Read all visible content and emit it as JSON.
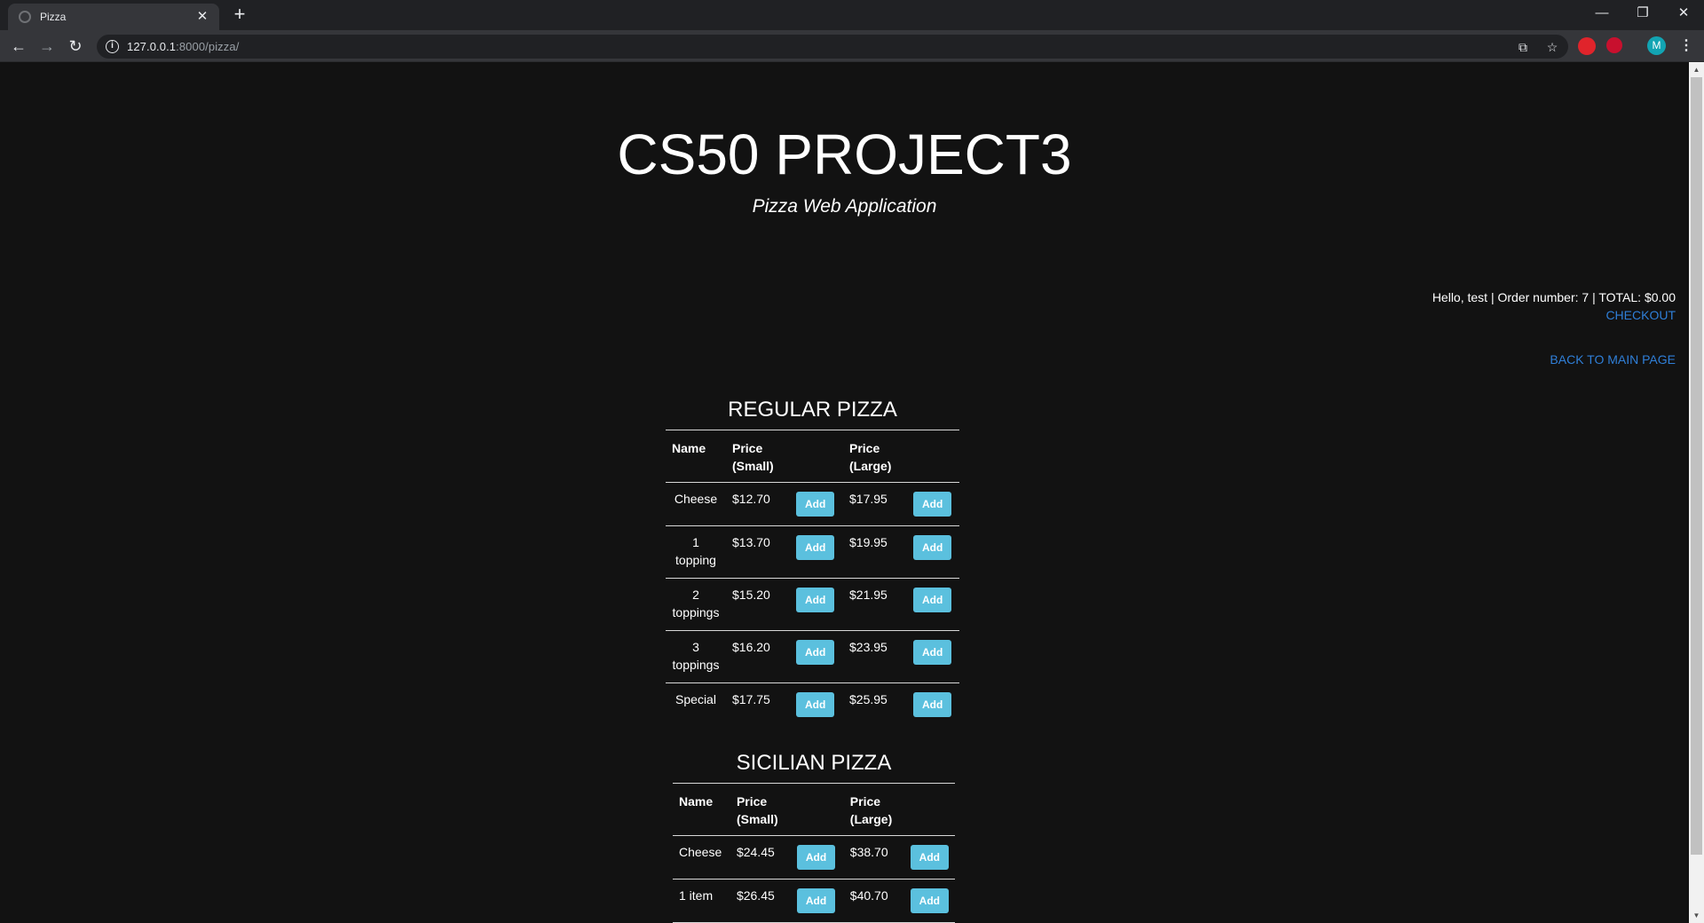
{
  "browser": {
    "tab_title": "Pizza",
    "url_host": "127.0.0.1",
    "url_rest": ":8000/pizza/",
    "profile_initial": "M"
  },
  "header": {
    "title": "CS50 PROJECT3",
    "subtitle": "Pizza Web Application"
  },
  "user_bar": {
    "info": "Hello, test | Order number: 7 | TOTAL: $0.00",
    "checkout_label": "CHECKOUT",
    "back_label": "BACK TO MAIN PAGE"
  },
  "regular": {
    "title": "REGULAR PIZZA",
    "col_name": "Name",
    "col_small_1": "Price",
    "col_small_2": "(Small)",
    "col_large_1": "Price",
    "col_large_2": "(Large)",
    "add_label": "Add",
    "rows": [
      {
        "name_1": "Cheese",
        "name_2": "",
        "small": "$12.70",
        "large": "$17.95"
      },
      {
        "name_1": "1",
        "name_2": "topping",
        "small": "$13.70",
        "large": "$19.95"
      },
      {
        "name_1": "2",
        "name_2": "toppings",
        "small": "$15.20",
        "large": "$21.95"
      },
      {
        "name_1": "3",
        "name_2": "toppings",
        "small": "$16.20",
        "large": "$23.95"
      },
      {
        "name_1": "Special",
        "name_2": "",
        "small": "$17.75",
        "large": "$25.95"
      }
    ]
  },
  "sicilian": {
    "title": "SICILIAN PIZZA",
    "col_name": "Name",
    "col_small_1": "Price",
    "col_small_2": "(Small)",
    "col_large_1": "Price",
    "col_large_2": "(Large)",
    "add_label": "Add",
    "rows": [
      {
        "name_1": "Cheese",
        "small": "$24.45",
        "large": "$38.70"
      },
      {
        "name_1": "1 item",
        "small": "$26.45",
        "large": "$40.70"
      }
    ]
  }
}
